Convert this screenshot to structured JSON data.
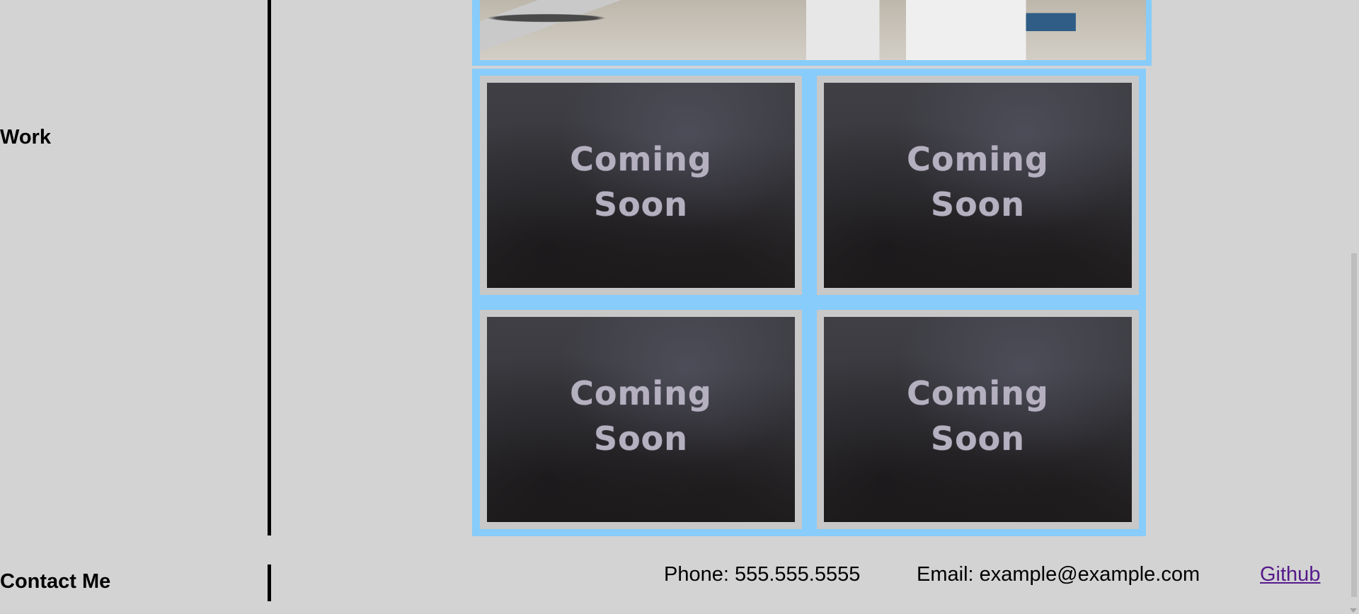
{
  "sections": {
    "work": "Work",
    "contact": "Contact Me"
  },
  "gallery": {
    "tiles": [
      {
        "line1": "Coming",
        "line2": "Soon"
      },
      {
        "line1": "Coming",
        "line2": "Soon"
      },
      {
        "line1": "Coming",
        "line2": "Soon"
      },
      {
        "line1": "Coming",
        "line2": "Soon"
      }
    ]
  },
  "contact": {
    "phone": "Phone: 555.555.5555",
    "email": "Email: example@example.com",
    "github": "Github"
  },
  "colors": {
    "background": "#d3d3d3",
    "gallery_frame": "#87ccfa",
    "link_visited": "#551a8b"
  }
}
